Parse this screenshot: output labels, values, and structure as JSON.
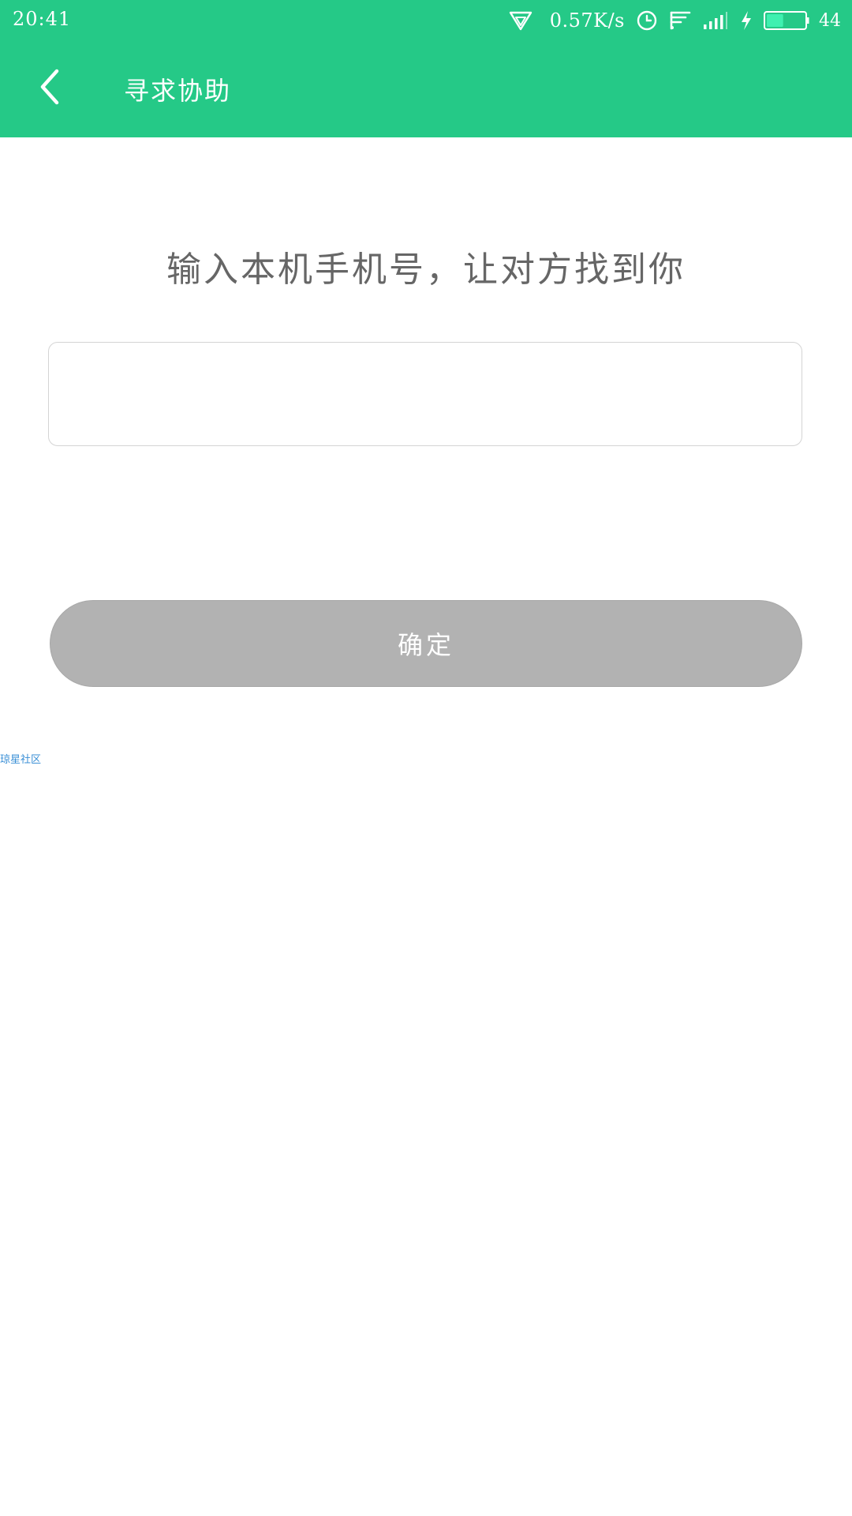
{
  "status_bar": {
    "time": "20:41",
    "net_speed": "0.57K/s",
    "battery_level": "44",
    "battery_fraction": 0.44,
    "icons": [
      "vpn-triangle-icon",
      "alarm-clock-icon",
      "wifi-icon",
      "signal-icon",
      "charging-bolt-icon",
      "battery-icon"
    ]
  },
  "toolbar": {
    "back_icon": "chevron-left-icon",
    "title": "寻求协助"
  },
  "main": {
    "prompt": "输入本机手机号，让对方找到你",
    "phone_input": {
      "value": "",
      "placeholder": ""
    },
    "confirm_label": "确定"
  },
  "watermark": {
    "text": "琼星社区"
  },
  "colors": {
    "header_bg": "#25C987",
    "button_disabled_bg": "#B2B2B2",
    "prompt_text": "#666666",
    "input_border": "#D4D4D4",
    "battery_fill": "#3FF0B0",
    "watermark": "#3A8FD6"
  }
}
